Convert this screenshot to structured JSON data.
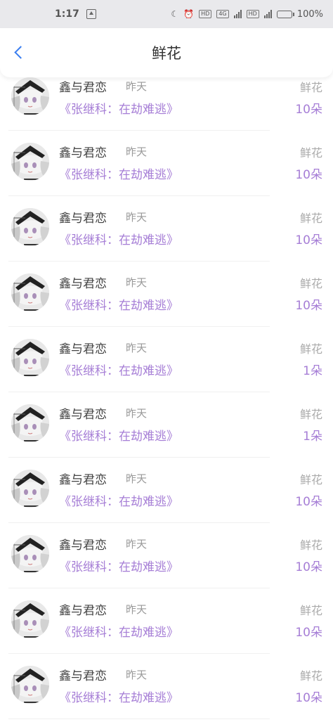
{
  "status_bar": {
    "time": "1:17",
    "battery_label": "100",
    "network_label": "4G"
  },
  "header": {
    "title": "鲜花"
  },
  "rows": [
    {
      "name": "鑫与君恋",
      "time": "昨天",
      "type": "鲜花",
      "book": "《张继科：在劫难逃》",
      "count": "10朵"
    },
    {
      "name": "鑫与君恋",
      "time": "昨天",
      "type": "鲜花",
      "book": "《张继科：在劫难逃》",
      "count": "10朵"
    },
    {
      "name": "鑫与君恋",
      "time": "昨天",
      "type": "鲜花",
      "book": "《张继科：在劫难逃》",
      "count": "10朵"
    },
    {
      "name": "鑫与君恋",
      "time": "昨天",
      "type": "鲜花",
      "book": "《张继科：在劫难逃》",
      "count": "10朵"
    },
    {
      "name": "鑫与君恋",
      "time": "昨天",
      "type": "鲜花",
      "book": "《张继科：在劫难逃》",
      "count": "1朵"
    },
    {
      "name": "鑫与君恋",
      "time": "昨天",
      "type": "鲜花",
      "book": "《张继科：在劫难逃》",
      "count": "1朵"
    },
    {
      "name": "鑫与君恋",
      "time": "昨天",
      "type": "鲜花",
      "book": "《张继科：在劫难逃》",
      "count": "10朵"
    },
    {
      "name": "鑫与君恋",
      "time": "昨天",
      "type": "鲜花",
      "book": "《张继科：在劫难逃》",
      "count": "10朵"
    },
    {
      "name": "鑫与君恋",
      "time": "昨天",
      "type": "鲜花",
      "book": "《张继科：在劫难逃》",
      "count": "10朵"
    },
    {
      "name": "鑫与君恋",
      "time": "昨天",
      "type": "鲜花",
      "book": "《张继科：在劫难逃》",
      "count": "10朵"
    }
  ],
  "colors": {
    "accent": "#3a7ef0",
    "purple": "#a67ed6",
    "muted": "#999999"
  },
  "icons": {
    "back": "chevron-left-icon",
    "avatar": "avatar-image"
  }
}
